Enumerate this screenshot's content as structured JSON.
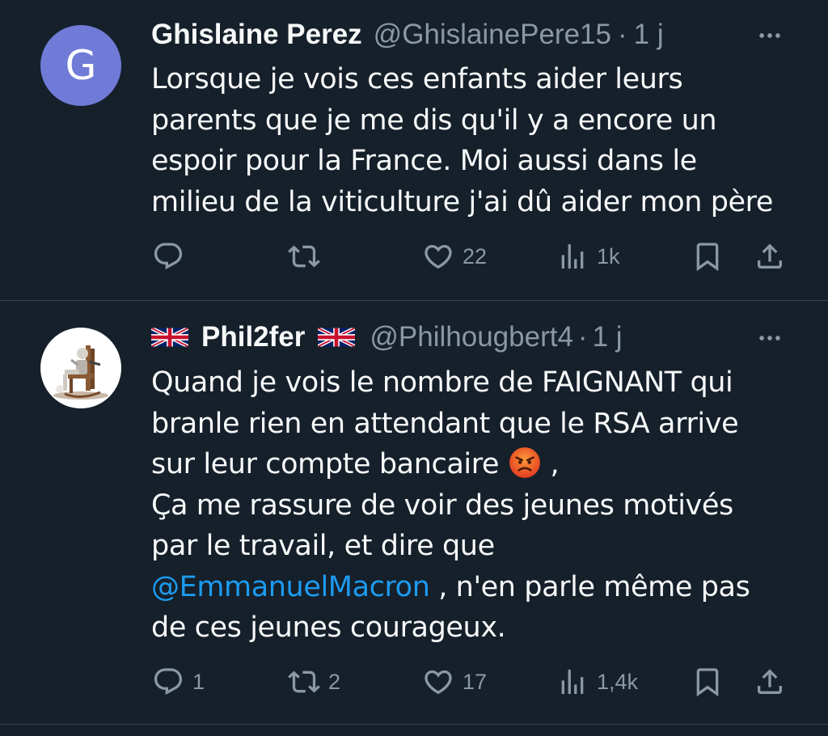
{
  "tweets": [
    {
      "avatar_letter": "G",
      "display_name": "Ghislaine Perez",
      "handle": "@GhislainePere15",
      "separator": "·",
      "time": "1 j",
      "body": [
        "Lorsque je vois ces enfants aider leurs",
        "parents que je me dis qu'il y a encore un",
        "espoir pour la France. Moi aussi dans le",
        "milieu de la viticulture j'ai dû aider mon père"
      ],
      "stats": {
        "replies": "",
        "retweets": "",
        "likes": "22",
        "views": "1k"
      }
    },
    {
      "avatar_image": "rocking-chair-figure",
      "display_name": "Phil2fer",
      "handle": "@Philhougbert4",
      "separator": "·",
      "time": "1 j",
      "body": {
        "line1": "Quand je vois le nombre de FAIGNANT qui",
        "line2": "branle rien en attendant que le RSA arrive",
        "line3": "sur leur compte bancaire",
        "line3_emoji": "angry-face-emoji",
        "line3_suffix": ",",
        "line4": "Ça me rassure de voir des jeunes motivés",
        "line5": "par le travail, et dire que",
        "mention": "@EmmanuelMacron",
        "line6_suffix": " , n'en parle même pas",
        "line7": "de ces jeunes courageux."
      },
      "stats": {
        "replies": "1",
        "retweets": "2",
        "likes": "17",
        "views": "1,4k"
      }
    }
  ],
  "colors": {
    "background": "#15202b",
    "text": "#f7f9f9",
    "secondary": "#8b98a5",
    "link": "#1d9bf0",
    "divider": "#38444d",
    "avatar_g": "#6f7bd6"
  },
  "icons": [
    "reply-icon",
    "retweet-icon",
    "like-icon",
    "views-icon",
    "bookmark-icon",
    "share-icon",
    "more-icon",
    "uk-flag-icon"
  ]
}
